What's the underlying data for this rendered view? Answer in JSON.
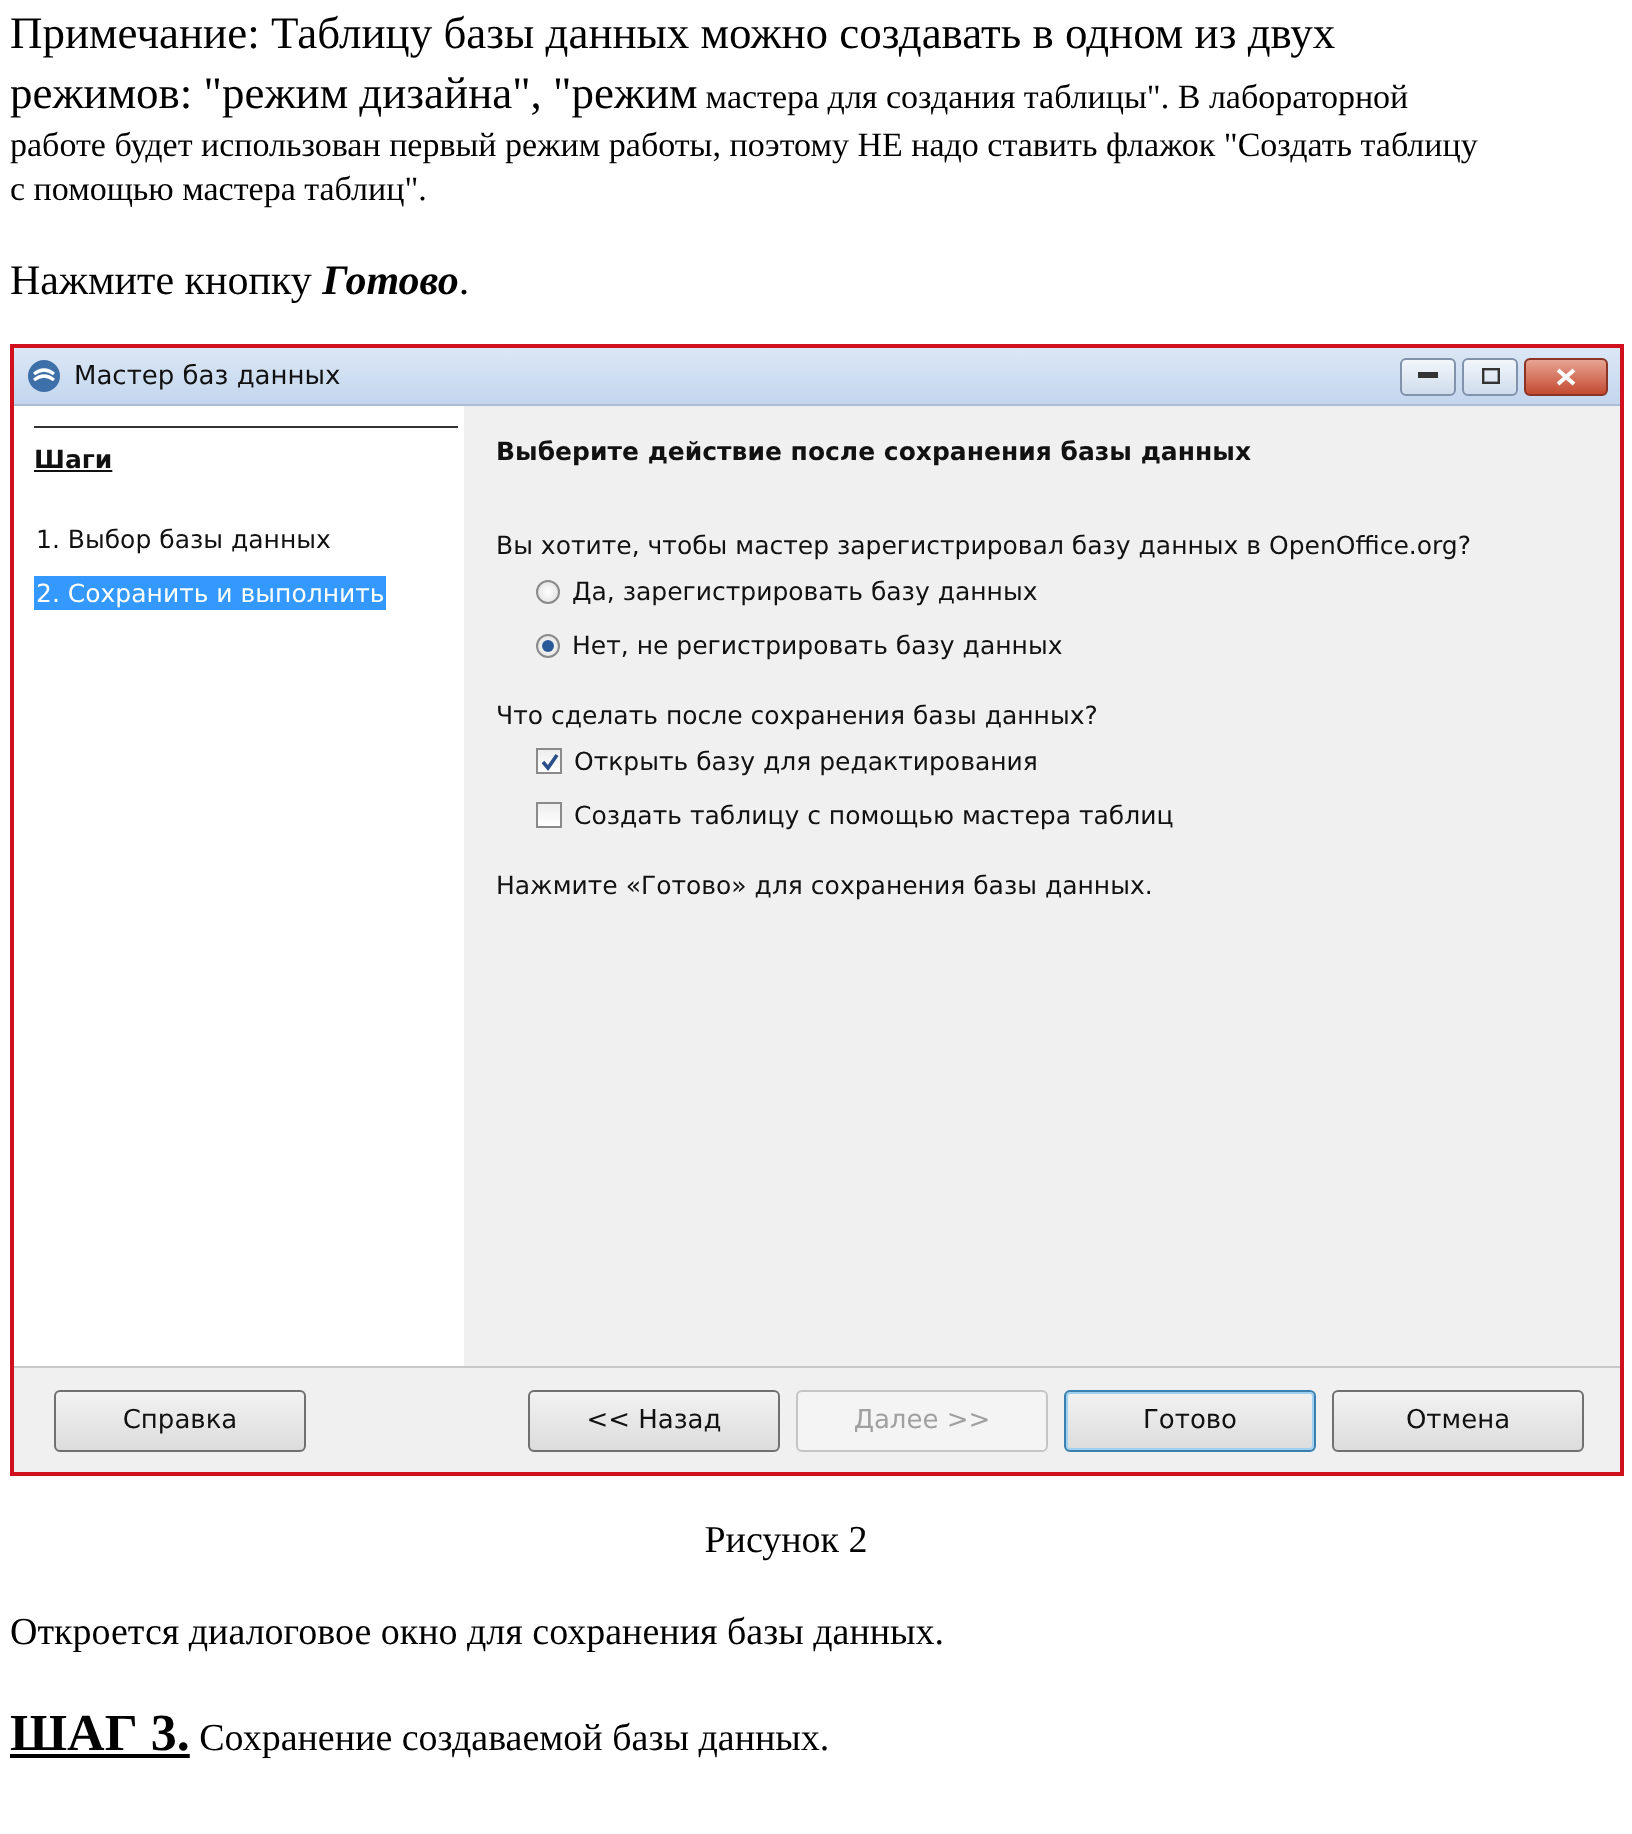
{
  "document_top": {
    "note_large": "Примечание: Таблицу базы данных можно создавать в одном из двух режимов: \"режим дизайна\", \"режим",
    "note_small": "мастера для создания таблицы\". В лабораторной работе будет использован первый режим работы, поэтому НЕ надо ставить флажок \"Создать таблицу с помощью мастера таблиц\".",
    "instruction": "Нажмите кнопку **Готово**."
  },
  "window": {
    "title": "Мастер баз данных"
  },
  "steps": {
    "heading": "Шаги",
    "items": [
      {
        "label": "1. Выбор базы данных",
        "selected": false
      },
      {
        "label": "2. Сохранить и выполнить",
        "selected": true
      }
    ]
  },
  "content": {
    "heading": "Выберите действие после сохранения базы данных",
    "question_1": "Вы хотите, чтобы мастер зарегистрировал базу данных в OpenOffice.org?",
    "radios": [
      {
        "label": "Да, зарегистрировать базу данных",
        "selected": false
      },
      {
        "label": "Нет, не регистрировать базу данных",
        "selected": true
      }
    ],
    "question_2": "Что сделать после сохранения базы данных?",
    "checkboxes": [
      {
        "label": "Открыть базу для редактирования",
        "checked": true
      },
      {
        "label": "Создать таблицу с помощью мастера таблиц",
        "checked": false
      }
    ],
    "hint": "Нажмите «Готово» для сохранения базы данных."
  },
  "buttons": [
    {
      "label": "Справка",
      "disabled": false,
      "default": false
    },
    {
      "label": "<< Назад",
      "disabled": false,
      "default": false
    },
    {
      "label": "Далее >>",
      "disabled": true,
      "default": false
    },
    {
      "label": "Готово",
      "disabled": false,
      "default": true
    },
    {
      "label": "Отмена",
      "disabled": false,
      "default": false
    }
  ],
  "document_bottom": {
    "caption": "Рисунок 2",
    "paragraph": "Откроется диалоговое окно для сохранения базы данных.",
    "step_label": "ШАГ 3.",
    "step_text": "Сохранение создаваемой базы данных."
  }
}
